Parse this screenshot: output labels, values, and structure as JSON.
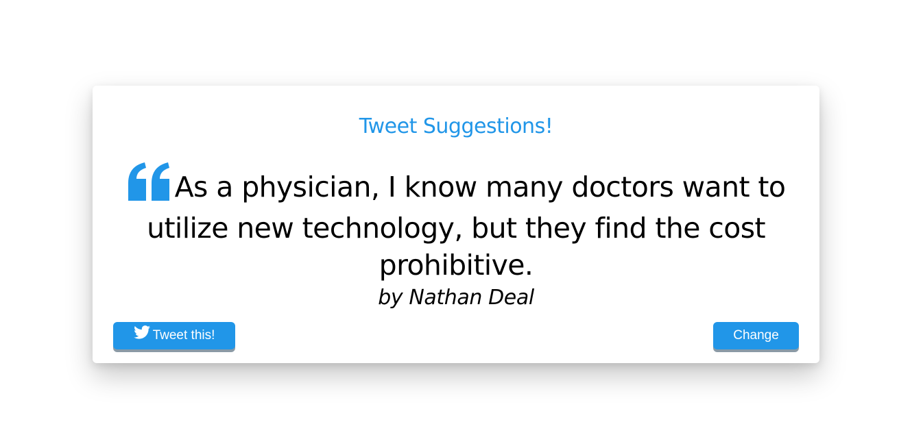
{
  "header": {
    "title": "Tweet Suggestions!"
  },
  "quote": {
    "text": "As a physician, I know many doctors want to utilize new technology, but they find the cost prohibitive.",
    "author": "by Nathan Deal",
    "icon": "quote-left-icon"
  },
  "actions": {
    "tweet_label": "Tweet this!",
    "tweet_icon": "twitter-icon",
    "change_label": "Change"
  },
  "colors": {
    "accent": "#2196e8",
    "text": "#000000",
    "background": "#ffffff"
  }
}
